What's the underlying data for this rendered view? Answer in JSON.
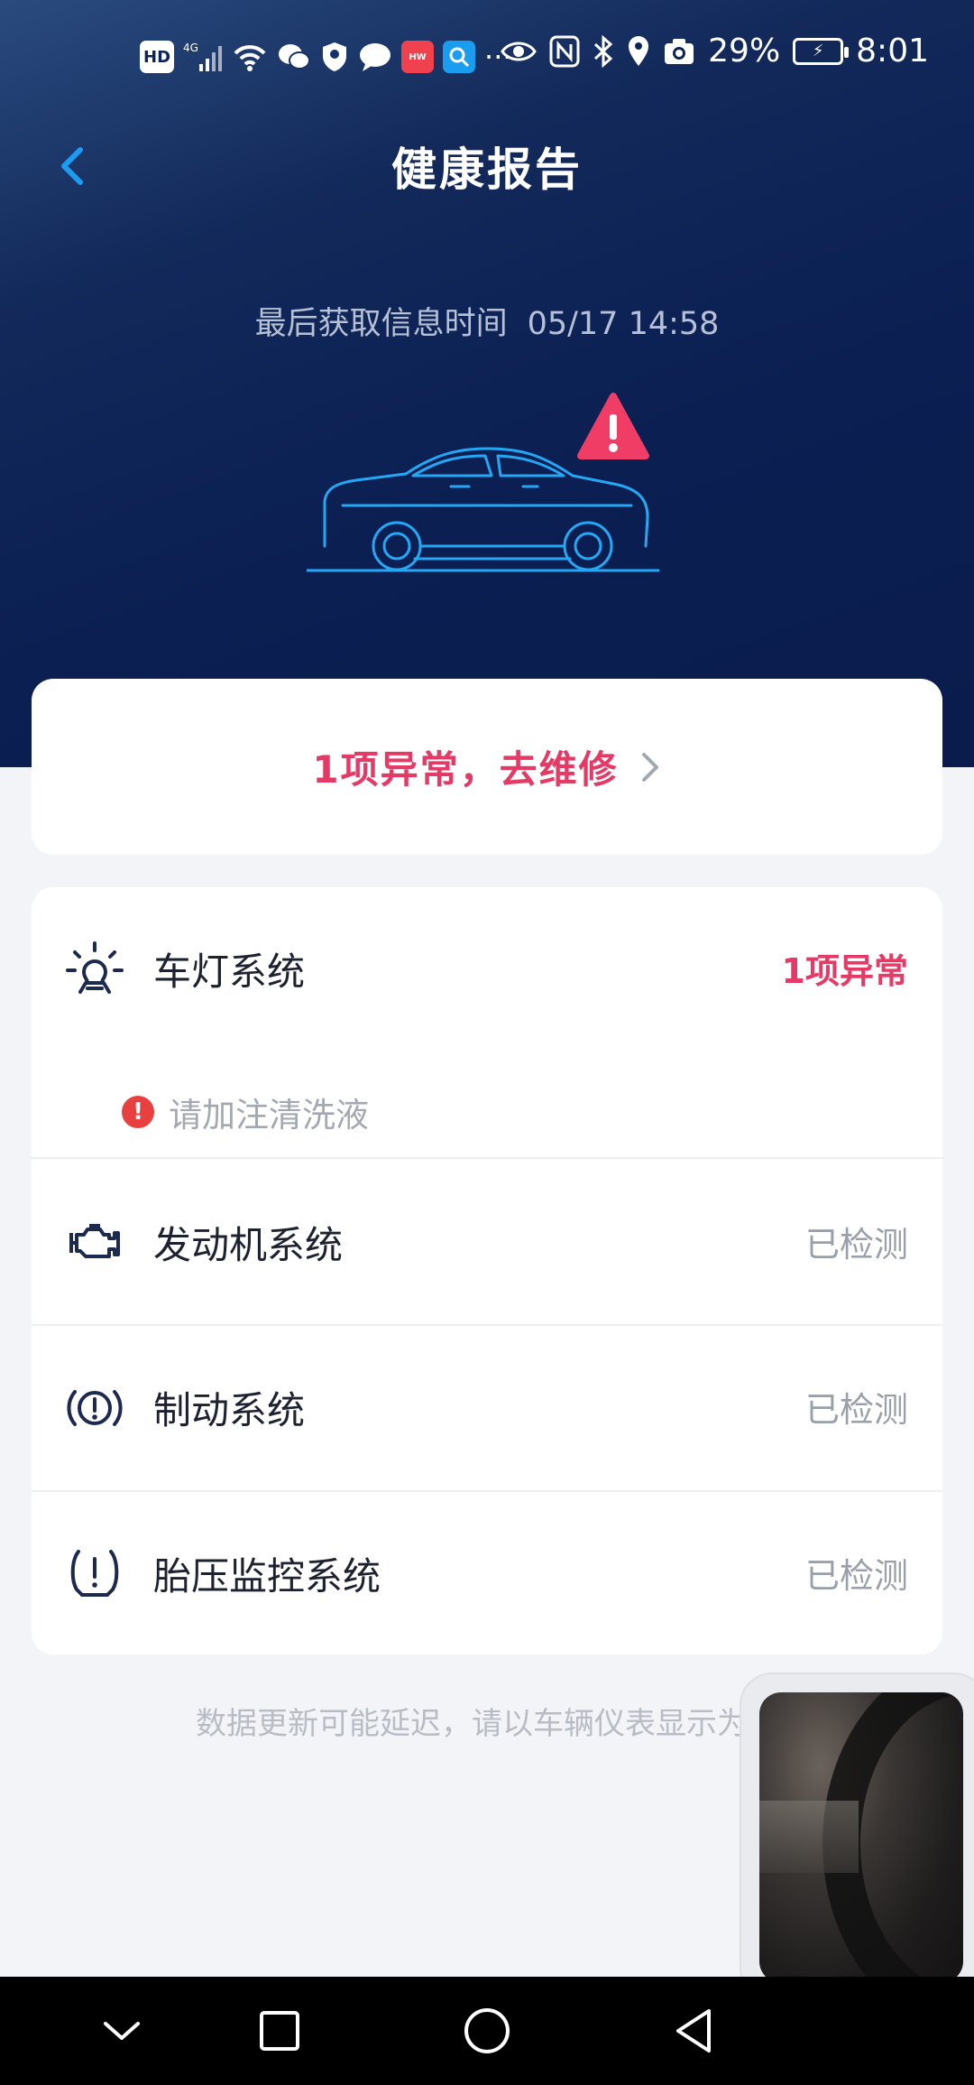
{
  "status_bar": {
    "left_badges": [
      "HD",
      "4G"
    ],
    "battery_percent": "29%",
    "time": "8:01",
    "icons": [
      "hd-icon",
      "signal-icon",
      "wifi-icon",
      "wechat-icon",
      "shield-icon",
      "message-icon",
      "huawei-app-icon",
      "search-app-icon",
      "more-icon",
      "eye-icon",
      "nfc-icon",
      "bluetooth-icon",
      "location-icon",
      "camera-icon",
      "battery-icon"
    ]
  },
  "header": {
    "title": "健康报告",
    "back_icon": "chevron-left-icon"
  },
  "update_info": {
    "label": "最后获取信息时间",
    "datetime": "05/17 14:58"
  },
  "alert_summary": {
    "text": "1项异常，去维修",
    "icon": "chevron-right-icon"
  },
  "systems": [
    {
      "icon": "light-bulb-icon",
      "label": "车灯系统",
      "status": "1项异常",
      "abnormal": true
    },
    {
      "icon": "engine-icon",
      "label": "发动机系统",
      "status": "已检测",
      "abnormal": false
    },
    {
      "icon": "brake-warning-icon",
      "label": "制动系统",
      "status": "已检测",
      "abnormal": false
    },
    {
      "icon": "tire-pressure-icon",
      "label": "胎压监控系统",
      "status": "已检测",
      "abnormal": false
    }
  ],
  "light_issue": {
    "text": "请加注清洗液",
    "icon": "warning-dot-icon"
  },
  "footer_note": "数据更新可能延迟，请以车辆仪表显示为准",
  "colors": {
    "header_bg": "#0b1f52",
    "accent_blue": "#1d9bf0",
    "alert_red": "#e63a66",
    "status_gray": "#9aa0aa"
  }
}
